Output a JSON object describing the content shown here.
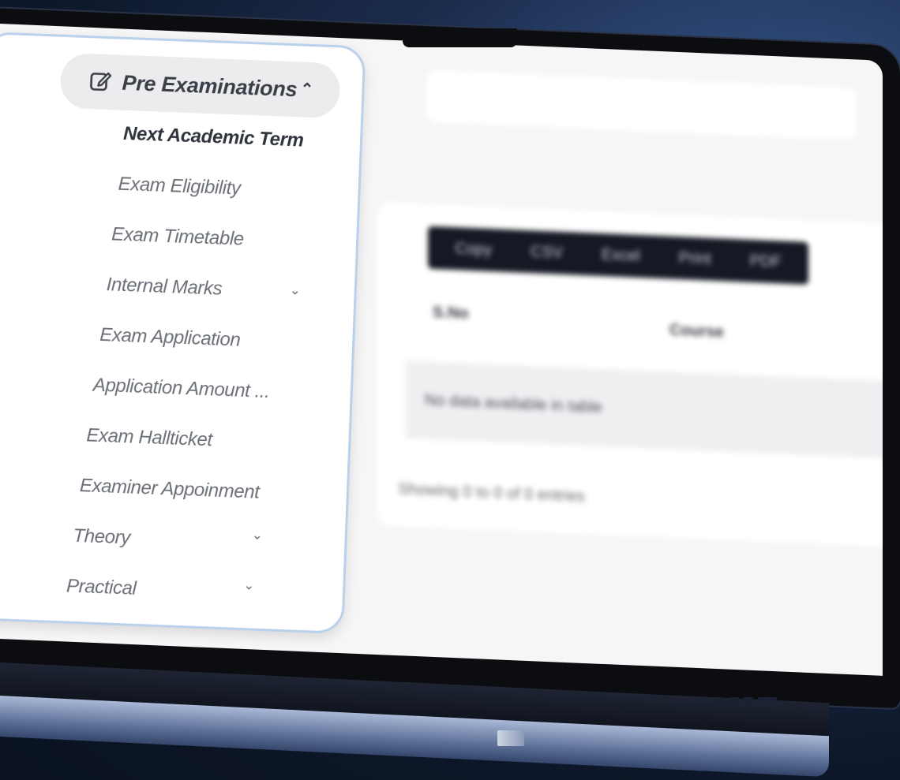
{
  "sidebar": {
    "header": {
      "label": "Pre Examinations",
      "icon": "edit-square-icon",
      "expanded": true
    },
    "items": [
      {
        "label": "Next Academic Term",
        "active": true
      },
      {
        "label": "Exam Eligibility"
      },
      {
        "label": "Exam Timetable"
      },
      {
        "label": "Internal Marks",
        "has_submenu": true
      },
      {
        "label": "Exam Application"
      },
      {
        "label": "Application Amount ..."
      },
      {
        "label": "Exam Hallticket"
      },
      {
        "label": "Examiner Appoinment"
      },
      {
        "label": "Theory",
        "has_submenu": true
      },
      {
        "label": "Practical",
        "has_submenu": true
      }
    ]
  },
  "main": {
    "export_buttons": [
      "Copy",
      "CSV",
      "Excel",
      "Print",
      "PDF"
    ],
    "table": {
      "columns": [
        "S.No",
        "Course"
      ],
      "empty_message": "No data available in table"
    },
    "info": "Showing 0 to 0 of 0 entries"
  },
  "colors": {
    "sidebar_border": "#b9d1ea",
    "header_pill": "#ececee",
    "export_bar": "#151923"
  }
}
